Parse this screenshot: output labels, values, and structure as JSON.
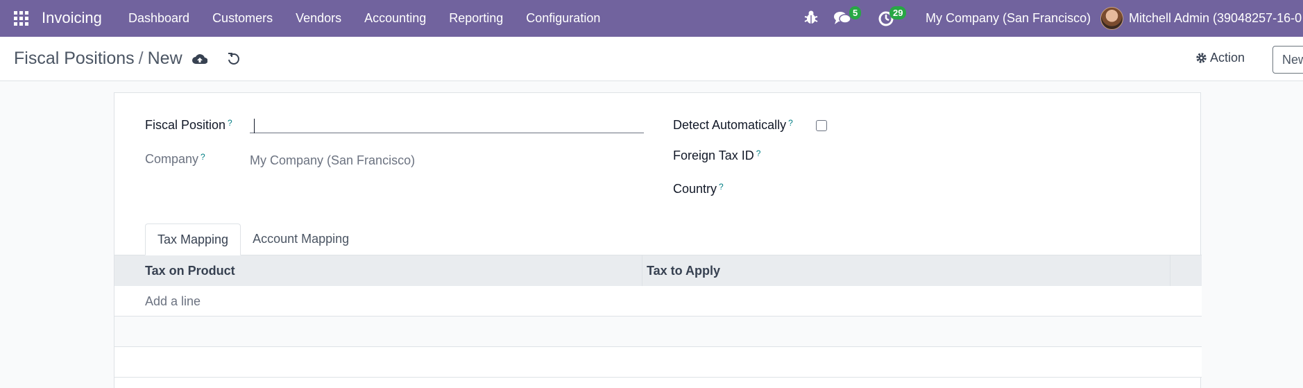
{
  "navbar": {
    "app_name": "Invoicing",
    "menu": [
      "Dashboard",
      "Customers",
      "Vendors",
      "Accounting",
      "Reporting",
      "Configuration"
    ],
    "chat_count": "5",
    "activity_count": "29",
    "company": "My Company (San Francisco)",
    "user": "Mitchell Admin (39048257-16-0",
    "color": "#71639e",
    "badge_color": "#28a745"
  },
  "control": {
    "breadcrumb_parent": "Fiscal Positions",
    "breadcrumb_sep": "/",
    "breadcrumb_current": "New",
    "action_label": "Action",
    "new_label": "New"
  },
  "form": {
    "fiscal_position_label": "Fiscal Position",
    "fiscal_position_value": "",
    "company_label": "Company",
    "company_value": "My Company (San Francisco)",
    "detect_label": "Detect Automatically",
    "detect_checked": false,
    "foreign_vat_label": "Foreign Tax ID",
    "country_label": "Country",
    "help_mark": "?"
  },
  "tabs": [
    {
      "label": "Tax Mapping",
      "active": true
    },
    {
      "label": "Account Mapping",
      "active": false
    }
  ],
  "table": {
    "columns": [
      "Tax on Product",
      "Tax to Apply"
    ],
    "add_line": "Add a line"
  }
}
